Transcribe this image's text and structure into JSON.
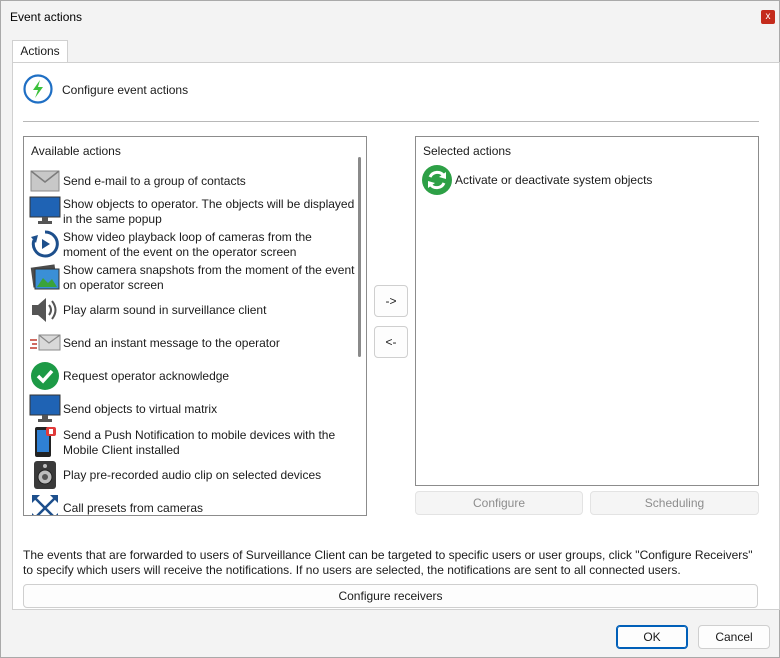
{
  "window": {
    "title": "Event actions",
    "close_label": "x"
  },
  "tabs": [
    {
      "label": "Actions"
    }
  ],
  "header": {
    "title": "Configure event actions",
    "icon": "lightning-icon"
  },
  "available": {
    "header": "Available actions",
    "items": [
      {
        "label": "Send e-mail to a group of contacts",
        "icon": "envelope-icon"
      },
      {
        "label": "Show objects to operator. The objects will be displayed in the same popup",
        "icon": "monitor-icon"
      },
      {
        "label": "Show video playback loop of cameras from the moment of the event on the operator screen",
        "icon": "playback-loop-icon"
      },
      {
        "label": "Show camera snapshots from the moment of the event on operator screen",
        "icon": "snapshot-icon"
      },
      {
        "label": "Play alarm sound in surveillance client",
        "icon": "speaker-icon"
      },
      {
        "label": "Send an instant message to the operator",
        "icon": "instant-message-icon"
      },
      {
        "label": "Request operator acknowledge",
        "icon": "checkmark-icon"
      },
      {
        "label": "Send objects to virtual matrix",
        "icon": "monitor-icon"
      },
      {
        "label": "Send a Push Notification to mobile devices with the Mobile Client installed",
        "icon": "mobile-notification-icon"
      },
      {
        "label": "Play pre-recorded audio clip on selected devices",
        "icon": "audio-device-icon"
      },
      {
        "label": "Call presets from cameras",
        "icon": "presets-icon"
      }
    ]
  },
  "selected": {
    "header": "Selected actions",
    "items": [
      {
        "label": "Activate or deactivate system objects",
        "icon": "refresh-icon"
      }
    ]
  },
  "buttons": {
    "add": "->",
    "remove": "<-",
    "configure": "Configure",
    "scheduling": "Scheduling",
    "configure_receivers": "Configure receivers",
    "ok": "OK",
    "cancel": "Cancel"
  },
  "info_text": "The events that are forwarded to users of Surveillance Client can be targeted to specific users or user groups, click \"Configure Receivers\" to specify which users will receive the notifications. If no users are selected, the notifications are sent to all connected users."
}
